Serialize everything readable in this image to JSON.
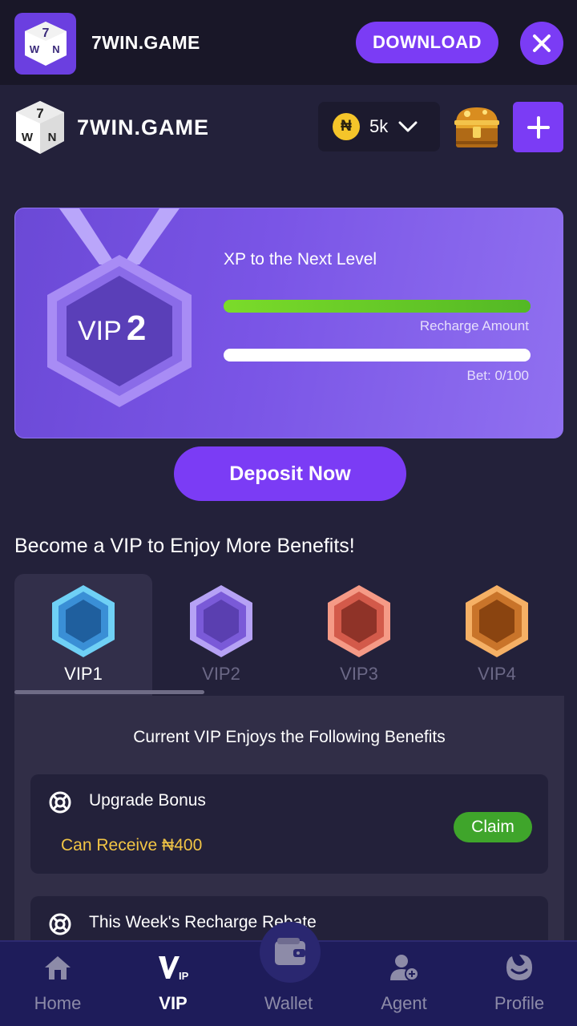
{
  "download_bar": {
    "app_name": "7WIN.GAME",
    "logo_text": "7WIN.GAME",
    "download_label": "DOWNLOAD"
  },
  "header": {
    "brand": "7WIN.GAME",
    "balance": "5k",
    "coin_symbol": "₦"
  },
  "vip_card": {
    "level_prefix": "VIP",
    "level_number": "2",
    "xp_title": "XP to the Next Level",
    "recharge_label": "Recharge Amount",
    "recharge_progress": 1.0,
    "bet_label": "Bet: 0/100",
    "bet_progress": 0.0
  },
  "deposit_label": "Deposit Now",
  "benefits_heading": "Become a VIP to Enjoy More Benefits!",
  "tabs": [
    {
      "label": "VIP1",
      "color": "#3a8fd6"
    },
    {
      "label": "VIP2",
      "color": "#7a5ad8"
    },
    {
      "label": "VIP3",
      "color": "#d35a4a"
    },
    {
      "label": "VIP4",
      "color": "#c9742a"
    }
  ],
  "panel": {
    "title": "Current VIP Enjoys the Following Benefits",
    "items": [
      {
        "name": "Upgrade Bonus",
        "sub": "Can Receive ₦400",
        "action": "Claim"
      },
      {
        "name": "This Week's Recharge Rebate"
      }
    ]
  },
  "nav": [
    {
      "label": "Home",
      "icon": "home-icon"
    },
    {
      "label": "VIP",
      "icon": "vip-icon"
    },
    {
      "label": "Wallet",
      "icon": "wallet-icon"
    },
    {
      "label": "Agent",
      "icon": "agent-icon"
    },
    {
      "label": "Profile",
      "icon": "profile-icon"
    }
  ],
  "colors": {
    "accent": "#7b3cf5",
    "background": "#23213a",
    "success": "#3fa52b",
    "gold": "#f2c545"
  }
}
